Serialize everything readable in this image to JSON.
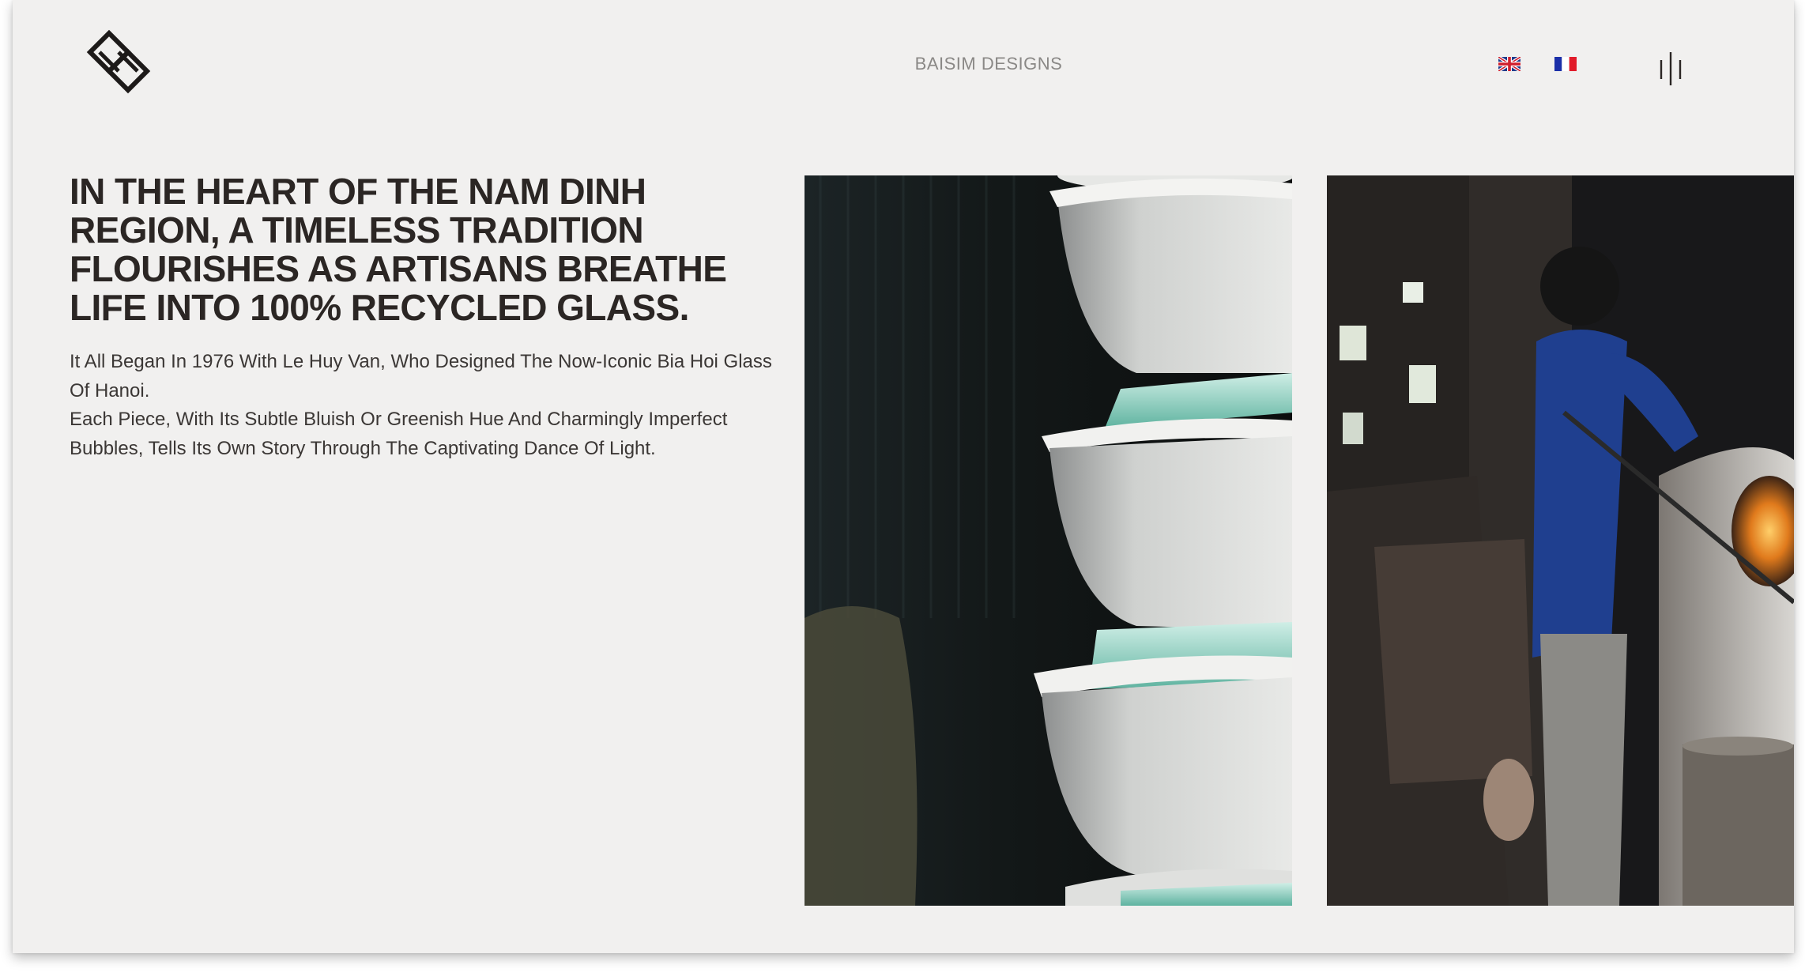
{
  "header": {
    "brand_name": "BAISIM DESIGNS",
    "language_options": [
      {
        "code": "en",
        "icon": "uk-flag-icon"
      },
      {
        "code": "fr",
        "icon": "france-flag-icon"
      }
    ],
    "menu_icon": "menu-bars-icon",
    "logo_icon": "diamond-logo-icon"
  },
  "hero": {
    "headline": "IN THE HEART OF THE NAM DINH REGION, A TIMELESS TRADITION FLOURISHES AS ARTISANS BREATHE LIFE INTO 100% RECYCLED GLASS.",
    "paragraph_1": "It All Began In 1976 With Le Huy Van, Who Designed The Now-Iconic Bia Hoi Glass Of Hanoi.",
    "paragraph_2": "Each Piece, With Its Subtle Bluish Or Greenish Hue And Charmingly Imperfect Bubbles, Tells Its Own Story Through The Captivating Dance Of Light."
  },
  "gallery": [
    {
      "subject": "stacked-bowls-of-recycled-glass-photo"
    },
    {
      "subject": "glassblower-at-furnace-photo"
    }
  ],
  "colors": {
    "page_background": "#f1f0ef",
    "headline_text": "#2b2624",
    "body_text": "#3b3735",
    "brand_text": "#8a8886"
  }
}
